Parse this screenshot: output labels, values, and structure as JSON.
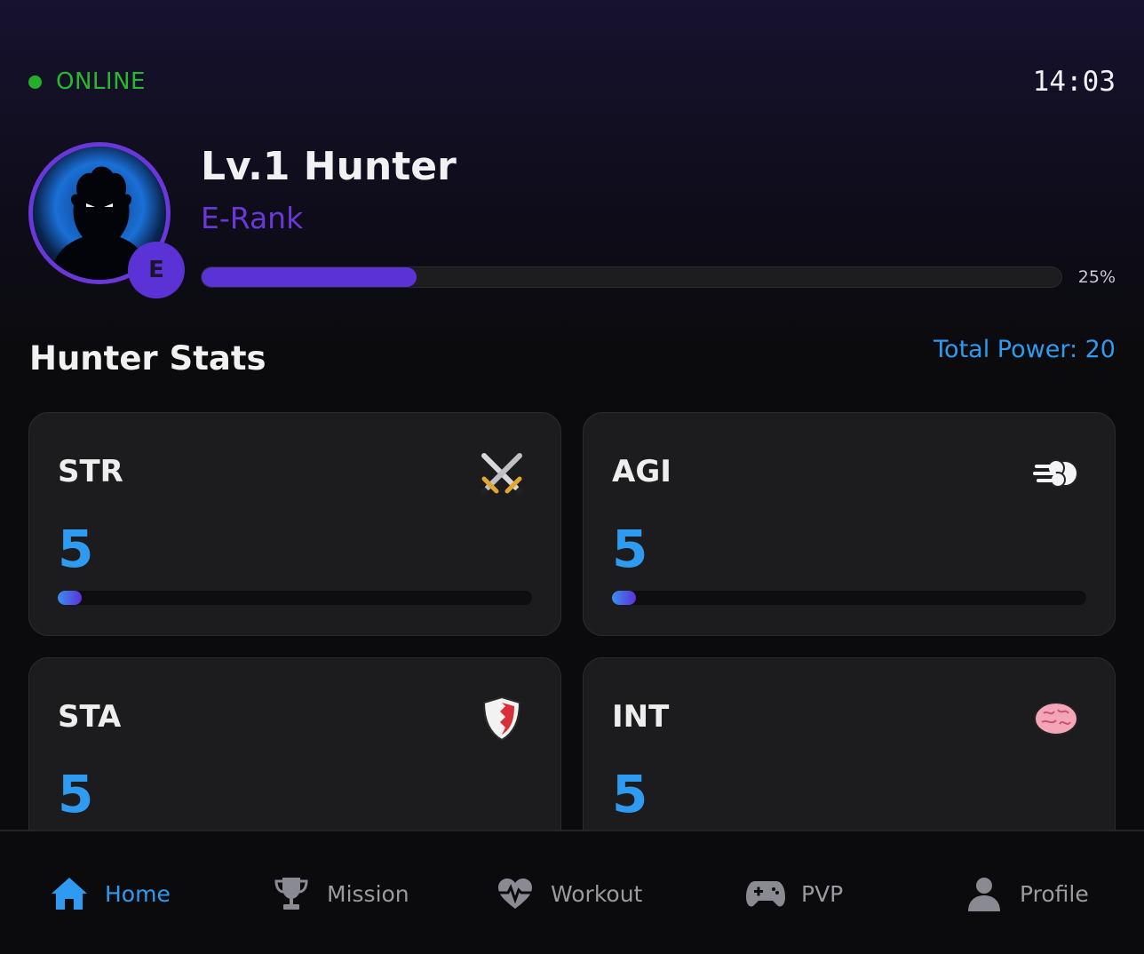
{
  "status": {
    "label": "ONLINE",
    "time": "14:03",
    "online_color": "#28b82f"
  },
  "hunter": {
    "level_title": "Lv.1 Hunter",
    "rank_label": "E-Rank",
    "rank_letter": "E",
    "xp_percent_text": "25%",
    "xp_fraction": 0.25,
    "accent_color": "#5b32d6"
  },
  "stats_section": {
    "title": "Hunter Stats",
    "total_power": "Total Power: 20"
  },
  "stats": [
    {
      "name": "STR",
      "value": "5",
      "icon": "crossed-swords-icon",
      "fill_fraction": 0.05
    },
    {
      "name": "AGI",
      "value": "5",
      "icon": "dash-wind-icon",
      "fill_fraction": 0.05
    },
    {
      "name": "STA",
      "value": "5",
      "icon": "shield-icon",
      "fill_fraction": 0.05
    },
    {
      "name": "INT",
      "value": "5",
      "icon": "brain-icon",
      "fill_fraction": 0.05
    }
  ],
  "nav": [
    {
      "label": "Home",
      "icon": "home-icon",
      "active": true
    },
    {
      "label": "Mission",
      "icon": "trophy-icon",
      "active": false
    },
    {
      "label": "Workout",
      "icon": "heartbeat-icon",
      "active": false
    },
    {
      "label": "PVP",
      "icon": "gamepad-icon",
      "active": false
    },
    {
      "label": "Profile",
      "icon": "user-icon",
      "active": false
    }
  ]
}
